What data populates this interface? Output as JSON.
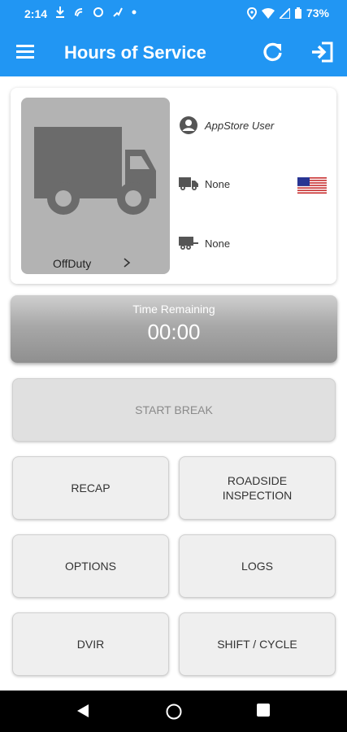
{
  "status_bar": {
    "time": "2:14",
    "battery": "73%",
    "left_icons": [
      "download-icon",
      "nfc-icon",
      "record-icon",
      "cast-icon",
      "dot-icon"
    ],
    "right_icons": [
      "location-icon",
      "wifi-icon",
      "signal-icon",
      "battery-icon"
    ]
  },
  "app_bar": {
    "title": "Hours of Service",
    "color": "#2196f3"
  },
  "driver_card": {
    "duty_status": "OffDuty",
    "user_name": "AppStore User",
    "truck": "None",
    "trailer": "None",
    "country_flag": "us-flag"
  },
  "time_panel": {
    "label": "Time Remaining",
    "value": "00:00"
  },
  "buttons": {
    "start_break": "START BREAK",
    "recap": "RECAP",
    "roadside_inspection": "ROADSIDE\nINSPECTION",
    "options": "OPTIONS",
    "logs": "LOGS",
    "dvir": "DVIR",
    "shift_cycle": "SHIFT / CYCLE"
  }
}
